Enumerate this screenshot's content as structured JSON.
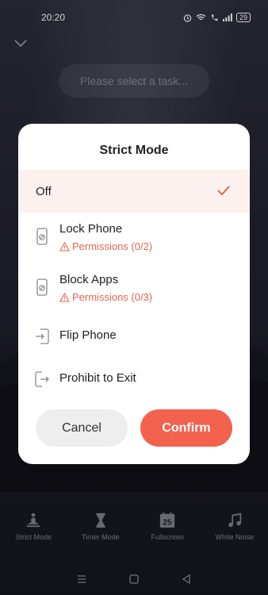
{
  "status_bar": {
    "time": "20:20",
    "battery": "29",
    "icons": [
      "alarm-icon",
      "wifi-icon",
      "phone-icon",
      "signal-icon",
      "battery-icon"
    ]
  },
  "task": {
    "placeholder": "Please select a task..."
  },
  "modal": {
    "title": "Strict Mode",
    "options": [
      {
        "label": "Off",
        "selected": true,
        "icon": "check-icon"
      },
      {
        "label": "Lock Phone",
        "warning": "Permissions (0/2)",
        "icon": "lock-phone-icon"
      },
      {
        "label": "Block Apps",
        "warning": "Permissions (0/3)",
        "icon": "block-apps-icon"
      },
      {
        "label": "Flip Phone",
        "icon": "flip-phone-icon"
      },
      {
        "label": "Prohibit to Exit",
        "icon": "exit-icon"
      }
    ],
    "cancel_label": "Cancel",
    "confirm_label": "Confirm"
  },
  "bottom_nav": [
    {
      "label": "Strict Mode",
      "icon": "meditation-icon"
    },
    {
      "label": "Timer Mode",
      "icon": "hourglass-icon"
    },
    {
      "label": "Fullscreen",
      "icon": "calendar-25-icon",
      "badge": "25"
    },
    {
      "label": "White Noise",
      "icon": "music-icon"
    }
  ],
  "colors": {
    "accent": "#f2624d",
    "warning": "#e8644f",
    "selected_bg": "#fdf1ef"
  }
}
